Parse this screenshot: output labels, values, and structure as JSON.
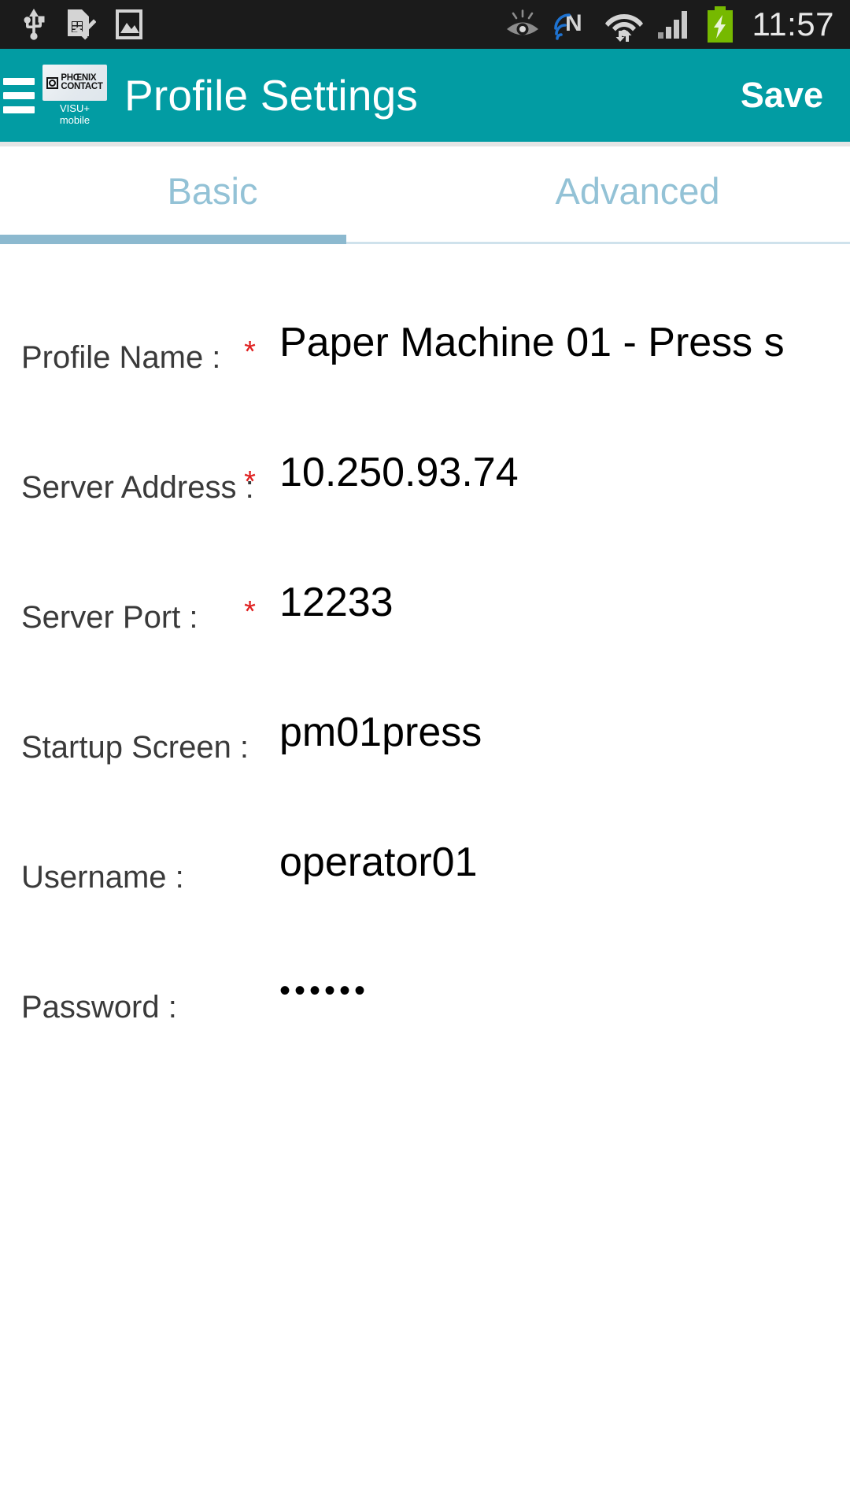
{
  "status_bar": {
    "time": "11:57",
    "left_icons": [
      {
        "name": "usb-icon"
      },
      {
        "name": "no-sim-card-icon"
      },
      {
        "name": "screenshot-image-icon"
      }
    ],
    "right_icons": [
      {
        "name": "smart-stay-eye-icon"
      },
      {
        "name": "nfc-icon"
      },
      {
        "name": "wifi-transfer-icon"
      },
      {
        "name": "cellular-signal-icon"
      },
      {
        "name": "battery-charging-icon"
      }
    ],
    "colors": {
      "background": "#1b1b1b",
      "icon": "#d4d4d4",
      "battery": "#76b900"
    }
  },
  "appbar": {
    "menu_icon": "hamburger-menu-icon",
    "logo": {
      "line1": "PHŒNIX",
      "line2": "CONTACT",
      "sub1": "VISU+",
      "sub2": "mobile"
    },
    "title": "Profile Settings",
    "save_label": "Save",
    "colors": {
      "background": "#029ca3",
      "text": "#ffffff"
    }
  },
  "tabs": {
    "items": [
      {
        "label": "Basic",
        "selected": true
      },
      {
        "label": "Advanced",
        "selected": false
      }
    ],
    "colors": {
      "label": "#93c2d6",
      "indicator_active": "#8cb9cf",
      "indicator_inactive": "#cfe2ec"
    }
  },
  "form": {
    "required_marker": "*",
    "fields": [
      {
        "label": "Profile Name :",
        "required": true,
        "value": "Paper Machine 01 - Press s",
        "placeholder": "Profile Name",
        "masked": false
      },
      {
        "label": "Server Address :",
        "required": true,
        "value": "10.250.93.74",
        "placeholder": "Server Address",
        "masked": false
      },
      {
        "label": "Server Port :",
        "required": true,
        "value": "12233",
        "placeholder": "Server Port",
        "masked": false
      },
      {
        "label": "Startup Screen :",
        "required": false,
        "value": "pm01press",
        "placeholder": "Startup Screen",
        "masked": false
      },
      {
        "label": "Username :",
        "required": false,
        "value": "operator01",
        "placeholder": "Username",
        "masked": false
      },
      {
        "label": "Password :",
        "required": false,
        "value": "••••••",
        "placeholder": "Password",
        "masked": true
      }
    ],
    "colors": {
      "label": "#3a3a3a",
      "value": "#000000",
      "required": "#e02020",
      "underline": "#b8b8b8"
    }
  }
}
